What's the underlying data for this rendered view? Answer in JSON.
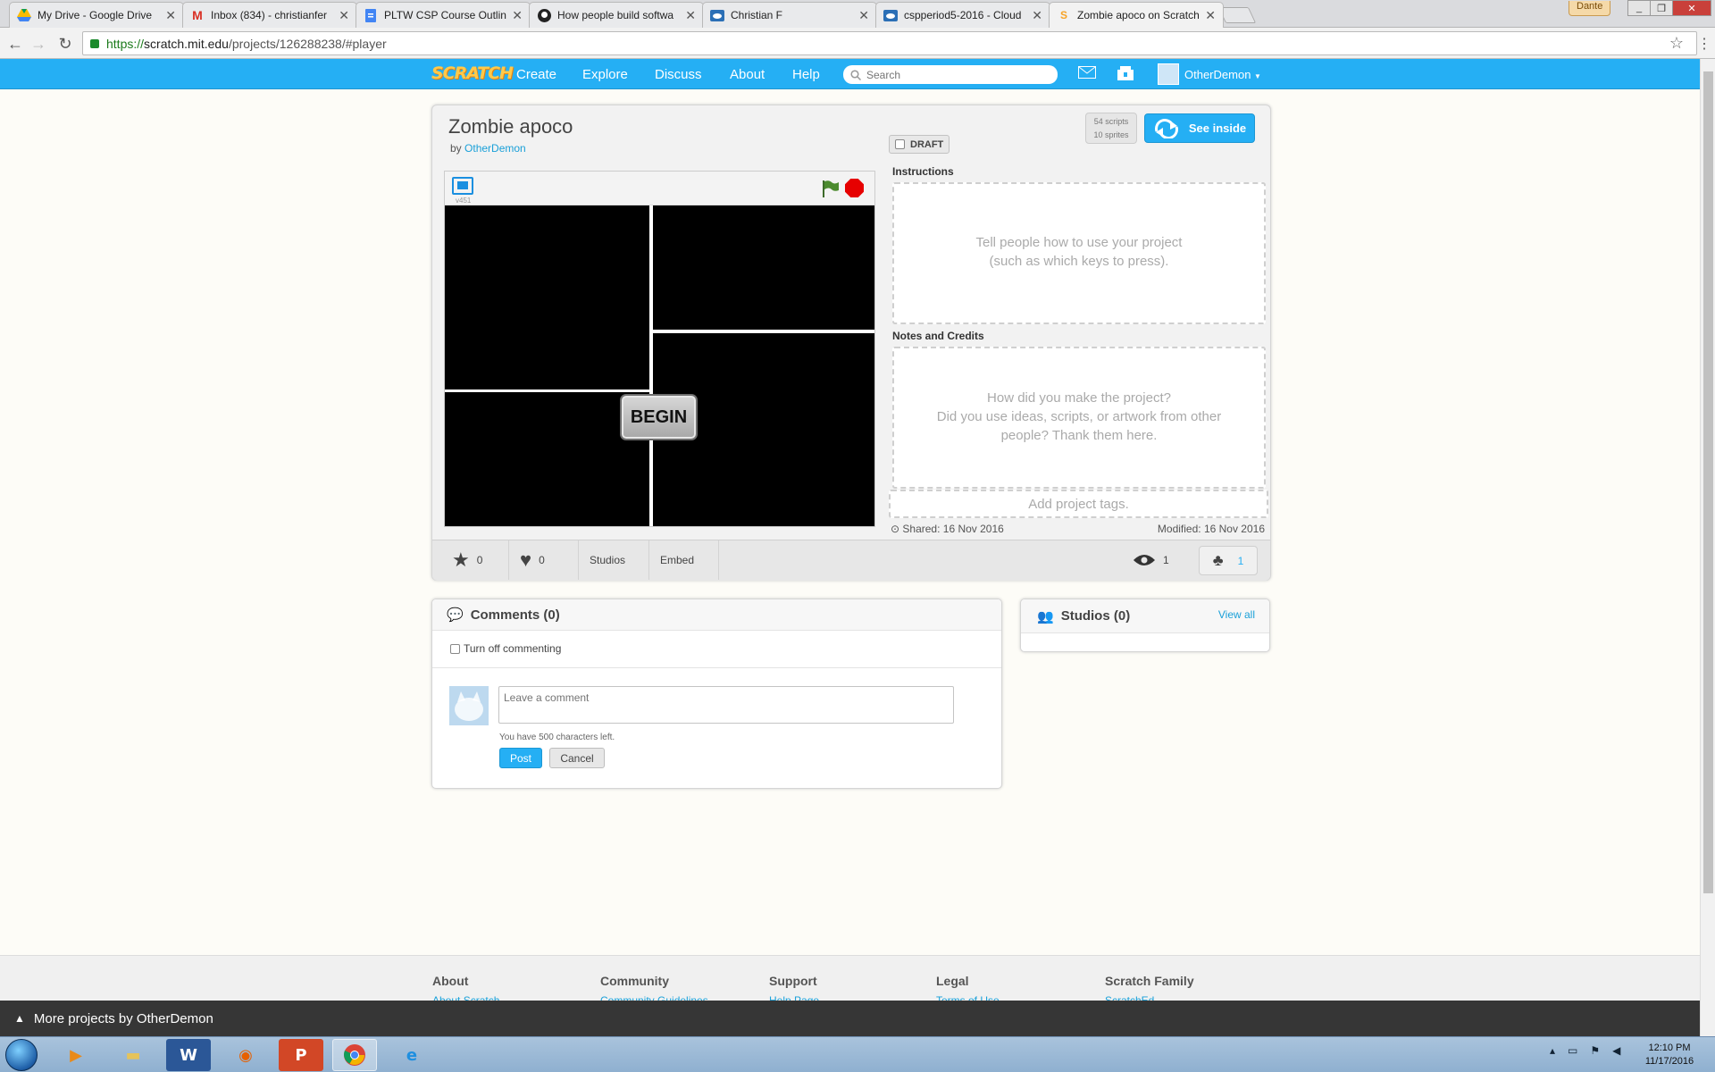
{
  "browser": {
    "tabs": [
      {
        "title": "My Drive - Google Drive",
        "icon": "google-drive-icon"
      },
      {
        "title": "Inbox (834) - christianfer",
        "icon": "gmail-icon"
      },
      {
        "title": "PLTW CSP Course Outline",
        "icon": "google-docs-icon"
      },
      {
        "title": "How people build softwa",
        "icon": "github-icon"
      },
      {
        "title": "Christian F",
        "icon": "cloud-icon"
      },
      {
        "title": "cspperiod5-2016 - Cloud",
        "icon": "cloud-icon"
      },
      {
        "title": "Zombie apoco on Scratch",
        "icon": "scratch-icon",
        "active": true
      }
    ],
    "profile_name": "Dante",
    "url_scheme": "https://",
    "url_host": "scratch.mit.edu",
    "url_path": "/projects/126288238/#player"
  },
  "nav": {
    "logo": "SCRATCH",
    "links": [
      "Create",
      "Explore",
      "Discuss",
      "About",
      "Help"
    ],
    "search_placeholder": "Search",
    "username": "OtherDemon"
  },
  "project": {
    "title": "Zombie apoco",
    "by_prefix": "by",
    "author": "OtherDemon",
    "draft_label": "DRAFT",
    "scripts_count": "54 scripts",
    "sprites_count": "10 sprites",
    "see_inside": "See inside",
    "version": "v451",
    "stage_button": "BEGIN",
    "instructions_label": "Instructions",
    "instructions_placeholder_1": "Tell people how to use your project",
    "instructions_placeholder_2": "(such as which keys to press).",
    "notes_label": "Notes and Credits",
    "notes_placeholder_1": "How did you make the project?",
    "notes_placeholder_2": "Did you use ideas, scripts, or artwork from other",
    "notes_placeholder_3": "people? Thank them here.",
    "tags_placeholder": "Add project tags.",
    "shared": "Shared: 16 Nov 2016",
    "modified": "Modified: 16 Nov 2016",
    "favorites": "0",
    "loves": "0",
    "studios_label": "Studios",
    "embed_label": "Embed",
    "views": "1",
    "remixes": "1"
  },
  "comments": {
    "heading": "Comments (0)",
    "turn_off": "Turn off commenting",
    "placeholder": "Leave a comment",
    "chars_left": "You have 500 characters left.",
    "post": "Post",
    "cancel": "Cancel"
  },
  "studios": {
    "heading": "Studios (0)",
    "view_all": "View all"
  },
  "footer": {
    "columns": [
      {
        "title": "About",
        "first": "About Scratch"
      },
      {
        "title": "Community",
        "first": "Community Guidelines"
      },
      {
        "title": "Support",
        "first": "Help Page"
      },
      {
        "title": "Legal",
        "first": "Terms of Use"
      },
      {
        "title": "Scratch Family",
        "first": "ScratchEd"
      }
    ],
    "more_projects": "More projects by OtherDemon"
  },
  "taskbar": {
    "apps": [
      "windows-media-player-icon",
      "file-explorer-icon",
      "word-icon",
      "firefox-icon",
      "powerpoint-icon",
      "chrome-icon",
      "internet-explorer-icon"
    ],
    "time": "12:10 PM",
    "date": "11/17/2016"
  },
  "colors": {
    "scratch_blue": "#25aff4",
    "link_blue": "#1aa0d8",
    "stop_red": "#e60000"
  }
}
